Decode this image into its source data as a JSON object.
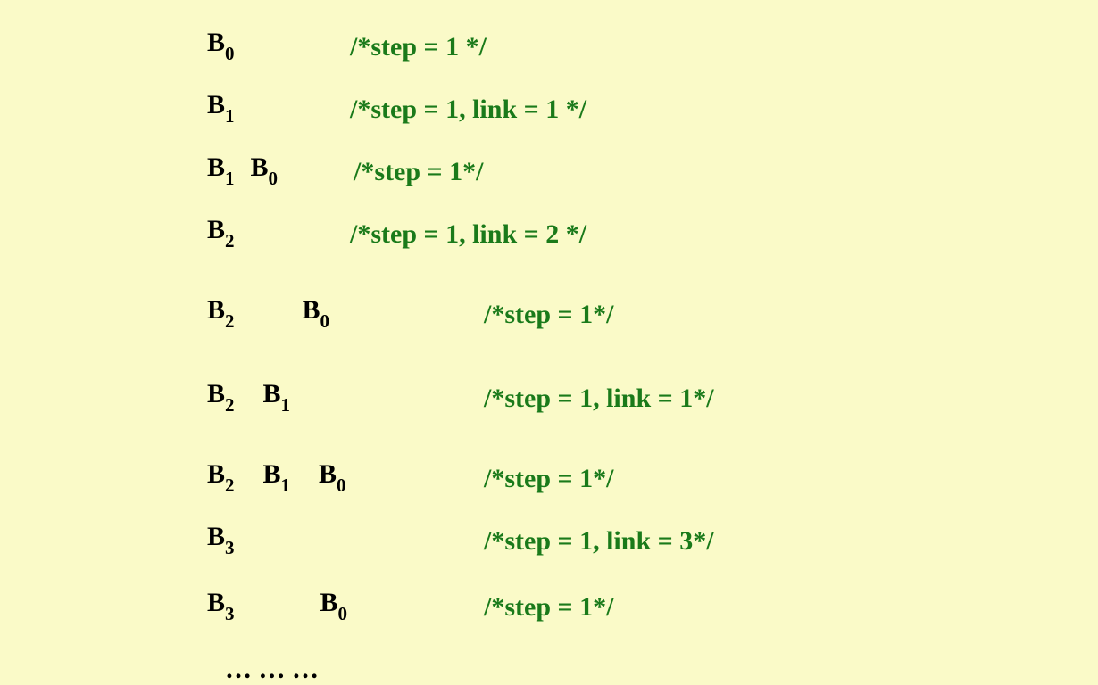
{
  "rows": [
    {
      "terms": [
        {
          "base": "B",
          "sub": "0"
        }
      ],
      "comment": "/*step = 1 */",
      "termsWidth": "w0",
      "rowClass": "r0"
    },
    {
      "terms": [
        {
          "base": "B",
          "sub": "1"
        }
      ],
      "comment": "/*step = 1, link = 1 */",
      "termsWidth": "w1",
      "rowClass": "r1"
    },
    {
      "terms": [
        {
          "base": "B",
          "sub": "1"
        },
        {
          "base": "B",
          "sub": "0"
        }
      ],
      "termGap": "18px",
      "comment": "/*step = 1*/",
      "termsWidth": "w2",
      "rowClass": "r2"
    },
    {
      "terms": [
        {
          "base": "B",
          "sub": "2"
        }
      ],
      "comment": "/*step = 1, link = 2 */",
      "termsWidth": "w3",
      "rowClass": "r3"
    },
    {
      "terms": [
        {
          "base": "B",
          "sub": "2"
        },
        {
          "base": "B",
          "sub": "0"
        }
      ],
      "termGap": "76px",
      "comment": "/*step = 1*/",
      "termsWidth": "w4",
      "rowClass": "r4"
    },
    {
      "terms": [
        {
          "base": "B",
          "sub": "2"
        },
        {
          "base": "B",
          "sub": "1"
        }
      ],
      "termGap": "32px",
      "comment": "/*step = 1, link = 1*/",
      "termsWidth": "w5",
      "rowClass": "r5"
    },
    {
      "terms": [
        {
          "base": "B",
          "sub": "2"
        },
        {
          "base": "B",
          "sub": "1"
        },
        {
          "base": "B",
          "sub": "0"
        }
      ],
      "termGap": "32px",
      "comment": "/*step = 1*/",
      "termsWidth": "w6",
      "rowClass": "r6"
    },
    {
      "terms": [
        {
          "base": "B",
          "sub": "3"
        }
      ],
      "comment": "/*step = 1, link = 3*/",
      "termsWidth": "w7",
      "rowClass": "r7"
    },
    {
      "terms": [
        {
          "base": "B",
          "sub": "3"
        },
        {
          "base": "B",
          "sub": "0"
        }
      ],
      "termGap": "96px",
      "comment": "/*step = 1*/",
      "termsWidth": "w8",
      "rowClass": "r8"
    }
  ],
  "ellipsis": "… … …"
}
